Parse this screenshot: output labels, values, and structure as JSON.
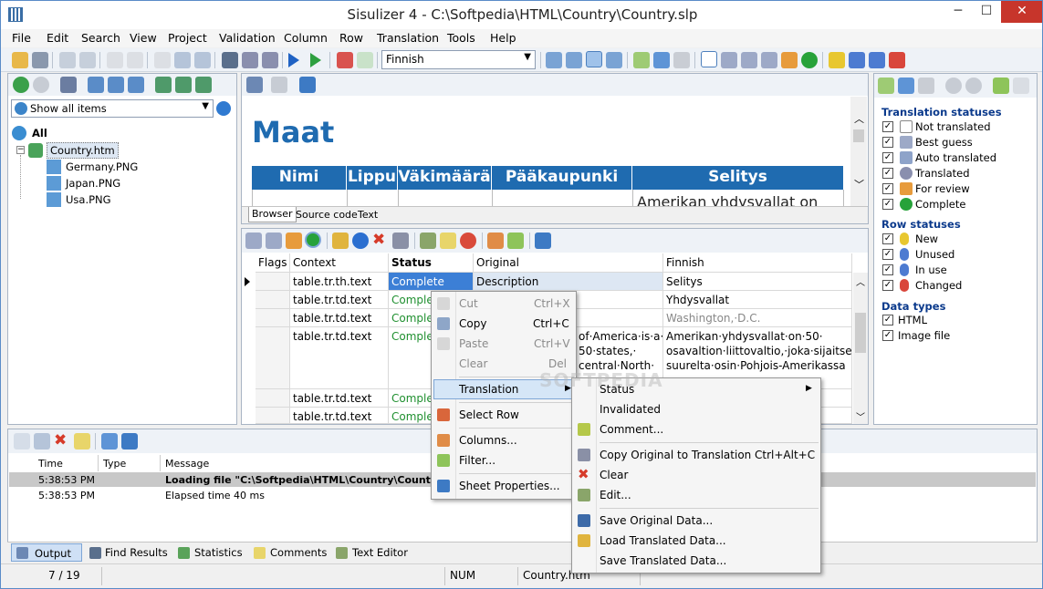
{
  "window": {
    "title": "Sisulizer 4 - C:\\Softpedia\\HTML\\Country\\Country.slp",
    "min": "─",
    "max": "☐",
    "close": "✕"
  },
  "menu": [
    "File",
    "Edit",
    "Search",
    "View",
    "Project",
    "Validation",
    "Column",
    "Row",
    "Translation",
    "Tools",
    "Help"
  ],
  "language_select": "Finnish",
  "left": {
    "filter": "Show all items",
    "tree": [
      "All",
      "Country.htm",
      "Germany.PNG",
      "Japan.PNG",
      "Usa.PNG"
    ]
  },
  "preview": {
    "heading": "Maat",
    "columns": [
      "Nimi",
      "Lippu",
      "Väkimäärä",
      "Pääkaupunki",
      "Selitys"
    ],
    "partial_text": "Amerikan yhdysvallat on",
    "tabs": [
      "Browser",
      "Source code",
      "Text"
    ]
  },
  "grid": {
    "headers": [
      "Flags",
      "Context",
      "Status",
      "Original",
      "Finnish"
    ],
    "rows": [
      {
        "context": "table.tr.th.text",
        "status": "Complete",
        "original": "Description",
        "finnish": "Selitys"
      },
      {
        "context": "table.tr.td.text",
        "status": "Comple",
        "original": "",
        "finnish": "Yhdysvallat"
      },
      {
        "context": "table.tr.td.text",
        "status": "Comple",
        "original": "",
        "finnish": "Washington,·D.C."
      },
      {
        "context": "table.tr.td.text",
        "status": "Comple",
        "original": "of·America·is·a·|50·states,·|central·North·",
        "finnish": "Amerikan·yhdysvallat·on·50·|osavaltion·liittovaltio,·joka·sijaitsee|suurelta·osin·Pohjois-Amerikassa"
      },
      {
        "context": "table.tr.td.text",
        "status": "Complete",
        "original": "",
        "finnish": ""
      },
      {
        "context": "table.tr.td.text",
        "status": "Complete",
        "original": "",
        "finnish": ""
      }
    ]
  },
  "right": {
    "group1": "Translation statuses",
    "statuses": [
      "Not translated",
      "Best guess",
      "Auto translated",
      "Translated",
      "For review",
      "Complete"
    ],
    "group2": "Row statuses",
    "rowstatuses": [
      "New",
      "Unused",
      "In use",
      "Changed"
    ],
    "group3": "Data types",
    "datatypes": [
      "HTML",
      "Image file"
    ]
  },
  "output": {
    "headers": [
      "Time",
      "Type",
      "Message"
    ],
    "rows": [
      {
        "time": "5:38:53 PM",
        "type": "",
        "message": "Loading file \"C:\\Softpedia\\HTML\\Country\\Country.s"
      },
      {
        "time": "5:38:53 PM",
        "type": "",
        "message": "Elapsed time 40 ms"
      }
    ],
    "tabs": [
      "Output",
      "Find Results",
      "Statistics",
      "Comments",
      "Text Editor"
    ]
  },
  "context_menu": {
    "items": [
      {
        "label": "Cut",
        "shortcut": "Ctrl+X",
        "disabled": true
      },
      {
        "label": "Copy",
        "shortcut": "Ctrl+C",
        "disabled": false
      },
      {
        "label": "Paste",
        "shortcut": "Ctrl+V",
        "disabled": true
      },
      {
        "label": "Clear",
        "shortcut": "Del",
        "disabled": true
      },
      {
        "label": "Translation",
        "shortcut": "",
        "disabled": false
      },
      {
        "label": "Select Row",
        "shortcut": "",
        "disabled": false
      },
      {
        "label": "Columns...",
        "shortcut": "",
        "disabled": false
      },
      {
        "label": "Filter...",
        "shortcut": "",
        "disabled": false
      },
      {
        "label": "Sheet Properties...",
        "shortcut": "",
        "disabled": false
      }
    ]
  },
  "submenu": {
    "items": [
      {
        "label": "Status",
        "shortcut": ""
      },
      {
        "label": "Invalidated",
        "shortcut": ""
      },
      {
        "label": "Comment...",
        "shortcut": ""
      },
      {
        "label": "Copy Original to Translation",
        "shortcut": "Ctrl+Alt+C"
      },
      {
        "label": "Clear",
        "shortcut": ""
      },
      {
        "label": "Edit...",
        "shortcut": ""
      },
      {
        "label": "Save Original Data...",
        "shortcut": ""
      },
      {
        "label": "Load Translated Data...",
        "shortcut": ""
      },
      {
        "label": "Save Translated Data...",
        "shortcut": ""
      }
    ]
  },
  "statusbar": {
    "position": "7 / 19",
    "num": "NUM",
    "file": "Country.htm"
  },
  "watermark": "SOFTPEDIA"
}
